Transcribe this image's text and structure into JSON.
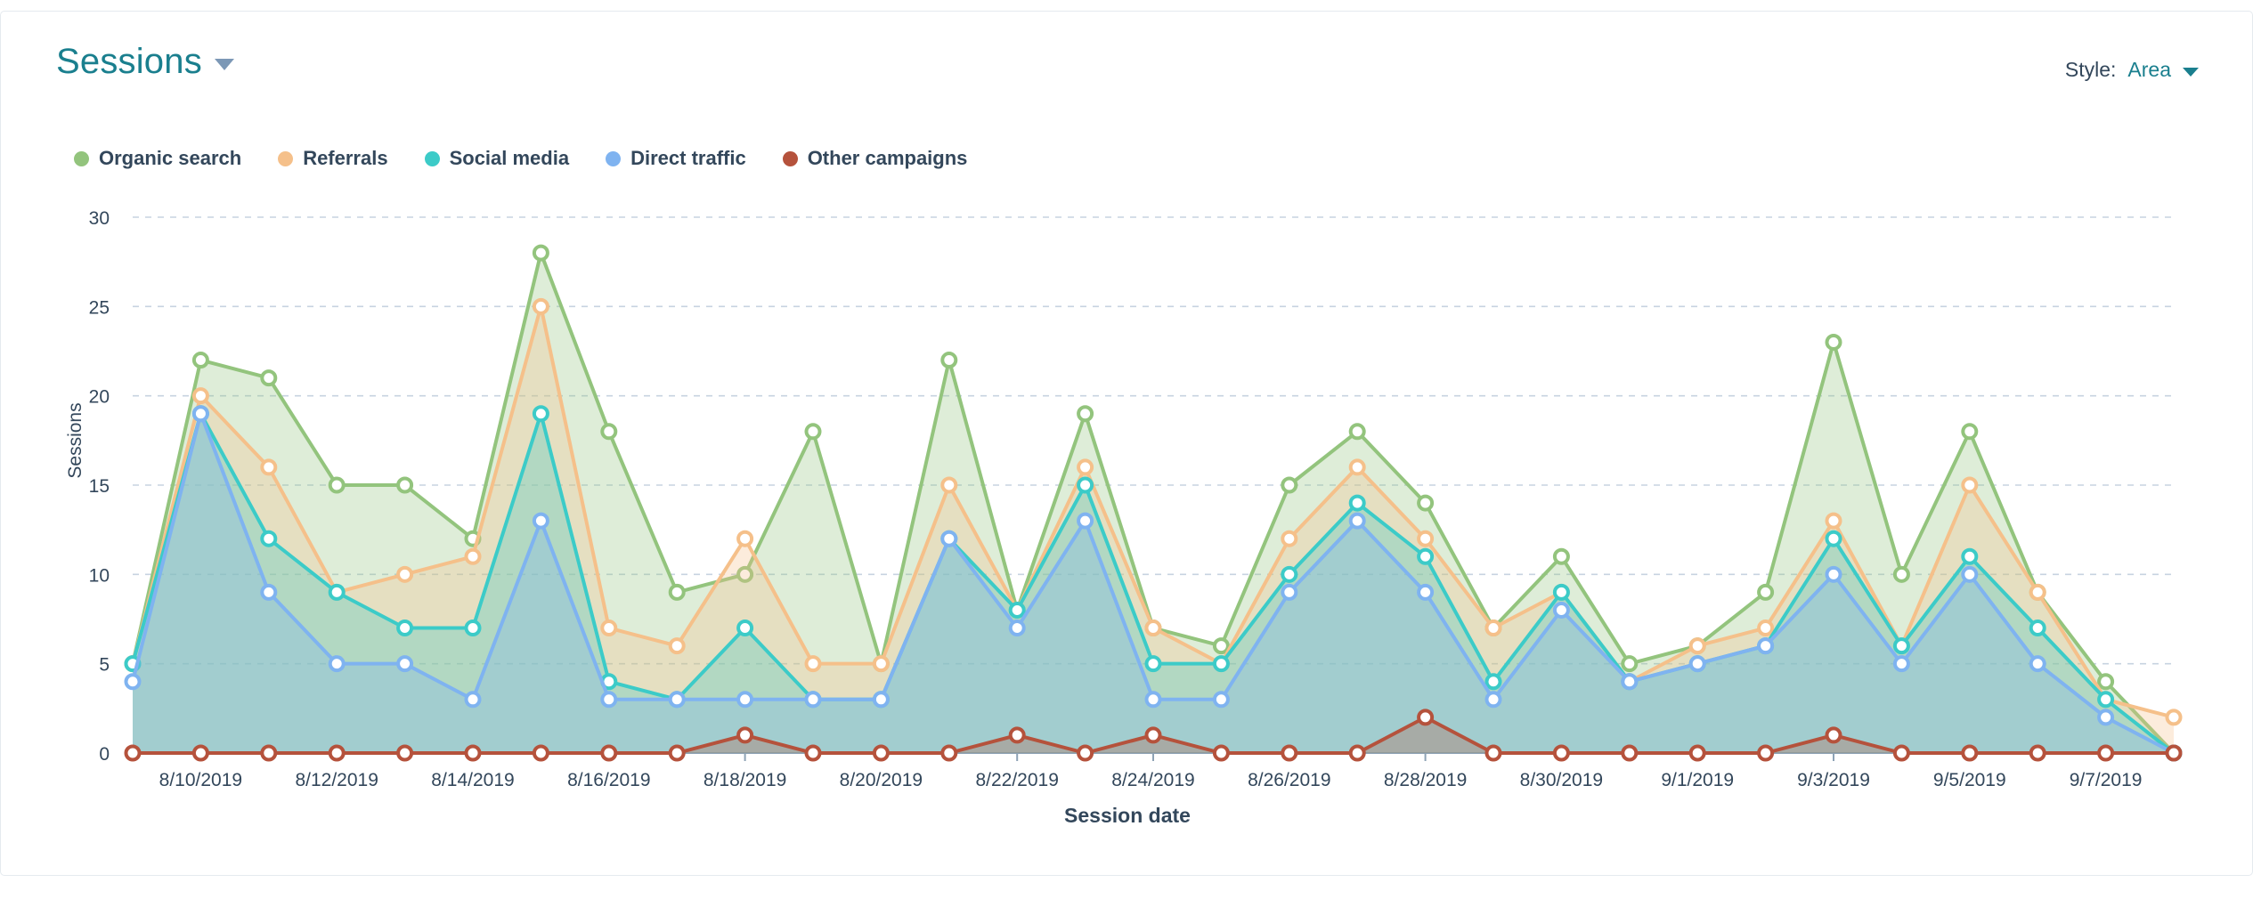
{
  "header": {
    "title": "Sessions",
    "title_caret_icon": "chevron-down-icon",
    "style_label": "Style:",
    "style_value": "Area",
    "style_caret_icon": "chevron-down-icon"
  },
  "legend": [
    {
      "label": "Organic search",
      "color": "#93C47D"
    },
    {
      "label": "Referrals",
      "color": "#F5C08A"
    },
    {
      "label": "Social media",
      "color": "#3CCBC8"
    },
    {
      "label": "Direct traffic",
      "color": "#7FB3F0"
    },
    {
      "label": "Other campaigns",
      "color": "#B5523C"
    }
  ],
  "chart_data": {
    "type": "area",
    "title": "Sessions",
    "xlabel": "Session date",
    "ylabel": "Sessions",
    "ylim": [
      0,
      30
    ],
    "yticks": [
      0,
      5,
      10,
      15,
      20,
      25,
      30
    ],
    "grid": true,
    "legend_position": "top-left",
    "stacked": false,
    "x": [
      "8/9/2019",
      "8/10/2019",
      "8/11/2019",
      "8/12/2019",
      "8/13/2019",
      "8/14/2019",
      "8/15/2019",
      "8/16/2019",
      "8/17/2019",
      "8/18/2019",
      "8/19/2019",
      "8/20/2019",
      "8/21/2019",
      "8/22/2019",
      "8/23/2019",
      "8/24/2019",
      "8/25/2019",
      "8/26/2019",
      "8/27/2019",
      "8/28/2019",
      "8/29/2019",
      "8/30/2019",
      "8/31/2019",
      "9/1/2019",
      "9/2/2019",
      "9/3/2019",
      "9/4/2019",
      "9/5/2019",
      "9/6/2019",
      "9/7/2019",
      "9/8/2019"
    ],
    "xtick_labels": [
      "8/10/2019",
      "8/12/2019",
      "8/14/2019",
      "8/16/2019",
      "8/18/2019",
      "8/20/2019",
      "8/22/2019",
      "8/24/2019",
      "8/26/2019",
      "8/28/2019",
      "8/30/2019",
      "9/1/2019",
      "9/3/2019",
      "9/5/2019",
      "9/7/2019"
    ],
    "xtick_indices": [
      1,
      3,
      5,
      7,
      9,
      11,
      13,
      15,
      17,
      19,
      21,
      23,
      25,
      27,
      29
    ],
    "series": [
      {
        "name": "Organic search",
        "color": "#93C47D",
        "fill": "#93C47D",
        "values": [
          5,
          22,
          21,
          15,
          15,
          12,
          28,
          18,
          9,
          10,
          18,
          5,
          22,
          8,
          19,
          7,
          6,
          15,
          18,
          14,
          7,
          11,
          5,
          6,
          9,
          23,
          10,
          18,
          9,
          4,
          0
        ]
      },
      {
        "name": "Referrals",
        "color": "#F5C08A",
        "fill": "#F5C08A",
        "values": [
          5,
          20,
          16,
          9,
          10,
          11,
          25,
          7,
          6,
          12,
          5,
          5,
          15,
          8,
          16,
          7,
          5,
          12,
          16,
          12,
          7,
          9,
          4,
          6,
          7,
          13,
          6,
          15,
          9,
          3,
          2
        ]
      },
      {
        "name": "Social media",
        "color": "#3CCBC8",
        "fill": "#3CCBC8",
        "values": [
          5,
          19,
          12,
          9,
          7,
          7,
          19,
          4,
          3,
          7,
          3,
          3,
          12,
          8,
          15,
          5,
          5,
          10,
          14,
          11,
          4,
          9,
          4,
          5,
          6,
          12,
          6,
          11,
          7,
          3,
          0
        ]
      },
      {
        "name": "Direct traffic",
        "color": "#7FB3F0",
        "fill": "#7FB3F0",
        "values": [
          4,
          19,
          9,
          5,
          5,
          3,
          13,
          3,
          3,
          3,
          3,
          3,
          12,
          7,
          13,
          3,
          3,
          9,
          13,
          9,
          3,
          8,
          4,
          5,
          6,
          10,
          5,
          10,
          5,
          2,
          0
        ]
      },
      {
        "name": "Other campaigns",
        "color": "#B5523C",
        "fill": "#B5523C",
        "values": [
          0,
          0,
          0,
          0,
          0,
          0,
          0,
          0,
          0,
          1,
          0,
          0,
          0,
          1,
          0,
          1,
          0,
          0,
          0,
          2,
          0,
          0,
          0,
          0,
          0,
          1,
          0,
          0,
          0,
          0,
          0
        ]
      }
    ]
  }
}
